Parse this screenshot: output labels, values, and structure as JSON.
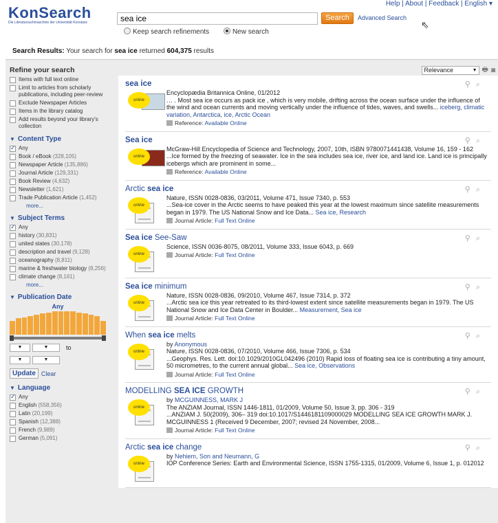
{
  "header": {
    "logo_text": "KonSearch",
    "logo_sub": "Die Literatursuchmaschine der Universität Konstanz",
    "links": [
      "Help",
      "About",
      "Feedback"
    ],
    "language": "English"
  },
  "search": {
    "query": "sea ice",
    "button_label": "Search",
    "advanced_label": "Advanced Search",
    "radio_keep": "Keep search refinements",
    "radio_new": "New search"
  },
  "summary": {
    "prefix": "Search Results:",
    "text_before": " Your search for ",
    "query": "sea ice",
    "text_mid": " returned ",
    "count": "604,375",
    "text_after": " results"
  },
  "sort": {
    "selected": "Relevance"
  },
  "sidebar": {
    "refine_title": "Refine your search",
    "refine_items": [
      {
        "label": "Items with full text online",
        "checked": false
      },
      {
        "label": "Limit to articles from scholarly publications, including peer-review",
        "checked": false
      },
      {
        "label": "Exclude Newspaper Articles",
        "checked": false
      },
      {
        "label": "Items in the library catalog",
        "checked": false
      },
      {
        "label": "Add results beyond your library's collection",
        "checked": false
      }
    ],
    "content_type": {
      "title": "Content Type",
      "items": [
        {
          "label": "Any",
          "count": "",
          "checked": true
        },
        {
          "label": "Book / eBook",
          "count": "(328,105)",
          "checked": false
        },
        {
          "label": "Newspaper Article",
          "count": "(135,886)",
          "checked": false
        },
        {
          "label": "Journal Article",
          "count": "(129,331)",
          "checked": false
        },
        {
          "label": "Book Review",
          "count": "(4,632)",
          "checked": false
        },
        {
          "label": "Newsletter",
          "count": "(1,621)",
          "checked": false
        },
        {
          "label": "Trade Publication Article",
          "count": "(1,452)",
          "checked": false
        }
      ],
      "more": "more..."
    },
    "subject_terms": {
      "title": "Subject Terms",
      "items": [
        {
          "label": "Any",
          "count": "",
          "checked": true
        },
        {
          "label": "history",
          "count": "(30,831)",
          "checked": false
        },
        {
          "label": "united states",
          "count": "(30,178)",
          "checked": false
        },
        {
          "label": "description and travel",
          "count": "(9,128)",
          "checked": false
        },
        {
          "label": "oceanography",
          "count": "(8,811)",
          "checked": false
        },
        {
          "label": "marine & freshwater biology",
          "count": "(8,256)",
          "checked": false
        },
        {
          "label": "climate change",
          "count": "(8,161)",
          "checked": false
        }
      ],
      "more": "more..."
    },
    "pub_date": {
      "title": "Publication Date",
      "any": "Any",
      "to": "to",
      "update": "Update",
      "clear": "Clear",
      "histogram": [
        0.6,
        0.7,
        0.75,
        0.8,
        0.85,
        0.9,
        0.95,
        1.0,
        1.0,
        1.0,
        1.0,
        0.95,
        0.9,
        0.85,
        0.8,
        0.6
      ]
    },
    "language": {
      "title": "Language",
      "items": [
        {
          "label": "Any",
          "count": "",
          "checked": true
        },
        {
          "label": "English",
          "count": "(558,356)",
          "checked": false
        },
        {
          "label": "Latin",
          "count": "(20,199)",
          "checked": false
        },
        {
          "label": "Spanish",
          "count": "(12,388)",
          "checked": false
        },
        {
          "label": "French",
          "count": "(9,989)",
          "checked": false
        },
        {
          "label": "German",
          "count": "(5,091)",
          "checked": false
        }
      ]
    }
  },
  "results": [
    {
      "title_parts": [
        {
          "t": "sea ice",
          "b": true
        }
      ],
      "thumb": "pic",
      "by": "",
      "meta": "Encyclopædia Britannica Online, 01/2012",
      "snippet": "… . Most sea ice occurs as pack ice , which is very mobile, drifting across the ocean surface under the influence of the wind and ocean currents and moving vertically under the influence of tides, waves, and swells... ",
      "links": "iceberg, climatic variation, Antarctica, ice, Arctic Ocean",
      "ref_label": "Reference:",
      "ref_link": "Available Online"
    },
    {
      "title_parts": [
        {
          "t": "Sea ice",
          "b": true
        }
      ],
      "thumb": "pic-red",
      "by": "",
      "meta": "McGraw-Hill Encyclopedia of Science and Technology, 2007, 10th, ISBN 9780071441438, Volume 16, 159 - 162",
      "snippet": "...Ice formed by the freezing of seawater. Ice in the sea includes sea ice, river ice, and land ice. Land ice is principally icebergs which are prominent in some...",
      "links": "",
      "ref_label": "Reference:",
      "ref_link": "Available Online"
    },
    {
      "title_parts": [
        {
          "t": "Arctic ",
          "b": false
        },
        {
          "t": "sea ice",
          "b": true
        }
      ],
      "thumb": "doc",
      "by": "",
      "meta": "Nature, ISSN 0028-0836, 03/2011, Volume 471, Issue 7340, p. 553",
      "snippet": "...Sea-ice cover in the Arctic seems to have peaked this year at the lowest maximum since satellite measurements began in 1979. The US National Snow and Ice Data... ",
      "links": "Sea ice, Research",
      "ref_label": "Journal Article:",
      "ref_link": "Full Text Online"
    },
    {
      "title_parts": [
        {
          "t": "Sea ice",
          "b": true
        },
        {
          "t": " See-Saw",
          "b": false
        }
      ],
      "thumb": "doc",
      "by": "",
      "meta": "Science, ISSN 0036-8075, 08/2011, Volume 333, Issue 6043, p. 669",
      "snippet": "",
      "links": "",
      "ref_label": "Journal Article:",
      "ref_link": "Full Text Online"
    },
    {
      "title_parts": [
        {
          "t": "Sea ice",
          "b": true
        },
        {
          "t": " minimum",
          "b": false
        }
      ],
      "thumb": "doc",
      "by": "",
      "meta": "Nature, ISSN 0028-0836, 09/2010, Volume 467, Issue 7314, p. 372",
      "snippet": "...Arctic sea ice this year retreated to its third-lowest extent since satellite measurements began in 1979. The US National Snow and Ice Data Center in Boulder... ",
      "links": "Measurement, Sea ice",
      "ref_label": "Journal Article:",
      "ref_link": "Full Text Online"
    },
    {
      "title_parts": [
        {
          "t": "When ",
          "b": false
        },
        {
          "t": "sea ice",
          "b": true
        },
        {
          "t": " melts",
          "b": false
        }
      ],
      "thumb": "doc",
      "by": "Anonymous",
      "meta": "Nature, ISSN 0028-0836, 07/2010, Volume 466, Issue 7306, p. 534",
      "snippet": "...Geophys. Res. Lett. doi:10.1029/2010GL042496 (2010) Rapid loss of floating sea ice is contributing a tiny amount, 50 micrometres, to the current annual global... ",
      "links": "Sea ice, Observations",
      "ref_label": "Journal Article:",
      "ref_link": "Full Text Online"
    },
    {
      "title_parts": [
        {
          "t": "MODELLING ",
          "b": false
        },
        {
          "t": "SEA ICE",
          "b": true
        },
        {
          "t": " GROWTH",
          "b": false
        }
      ],
      "thumb": "doc",
      "by": "MCGUINNESS, MARK J",
      "meta": "The ANZIAM Journal, ISSN 1446-1811, 01/2009, Volume 50, Issue 3, pp. 306 - 319",
      "snippet": "...ANZIAM J. 50(2009), 306– 319 doi:10.1017/S1446181109000029 MODELLING SEA ICE GROWTH MARK J. MCGUINNESS 1 (Received 9 December, 2007; revised 24 November, 2008...",
      "links": "",
      "ref_label": "Journal Article:",
      "ref_link": "Full Text Online"
    },
    {
      "title_parts": [
        {
          "t": "Arctic ",
          "b": false
        },
        {
          "t": "sea ice",
          "b": true
        },
        {
          "t": " change",
          "b": false
        }
      ],
      "thumb": "doc",
      "by": "Nehiem, Son and Neumann, G",
      "meta": "IOP Conference Series: Earth and Environmental Science, ISSN 1755-1315, 01/2009, Volume 6, Issue 1, p. 012012",
      "snippet": "",
      "links": "",
      "ref_label": "",
      "ref_link": ""
    }
  ],
  "badge_text": "online"
}
